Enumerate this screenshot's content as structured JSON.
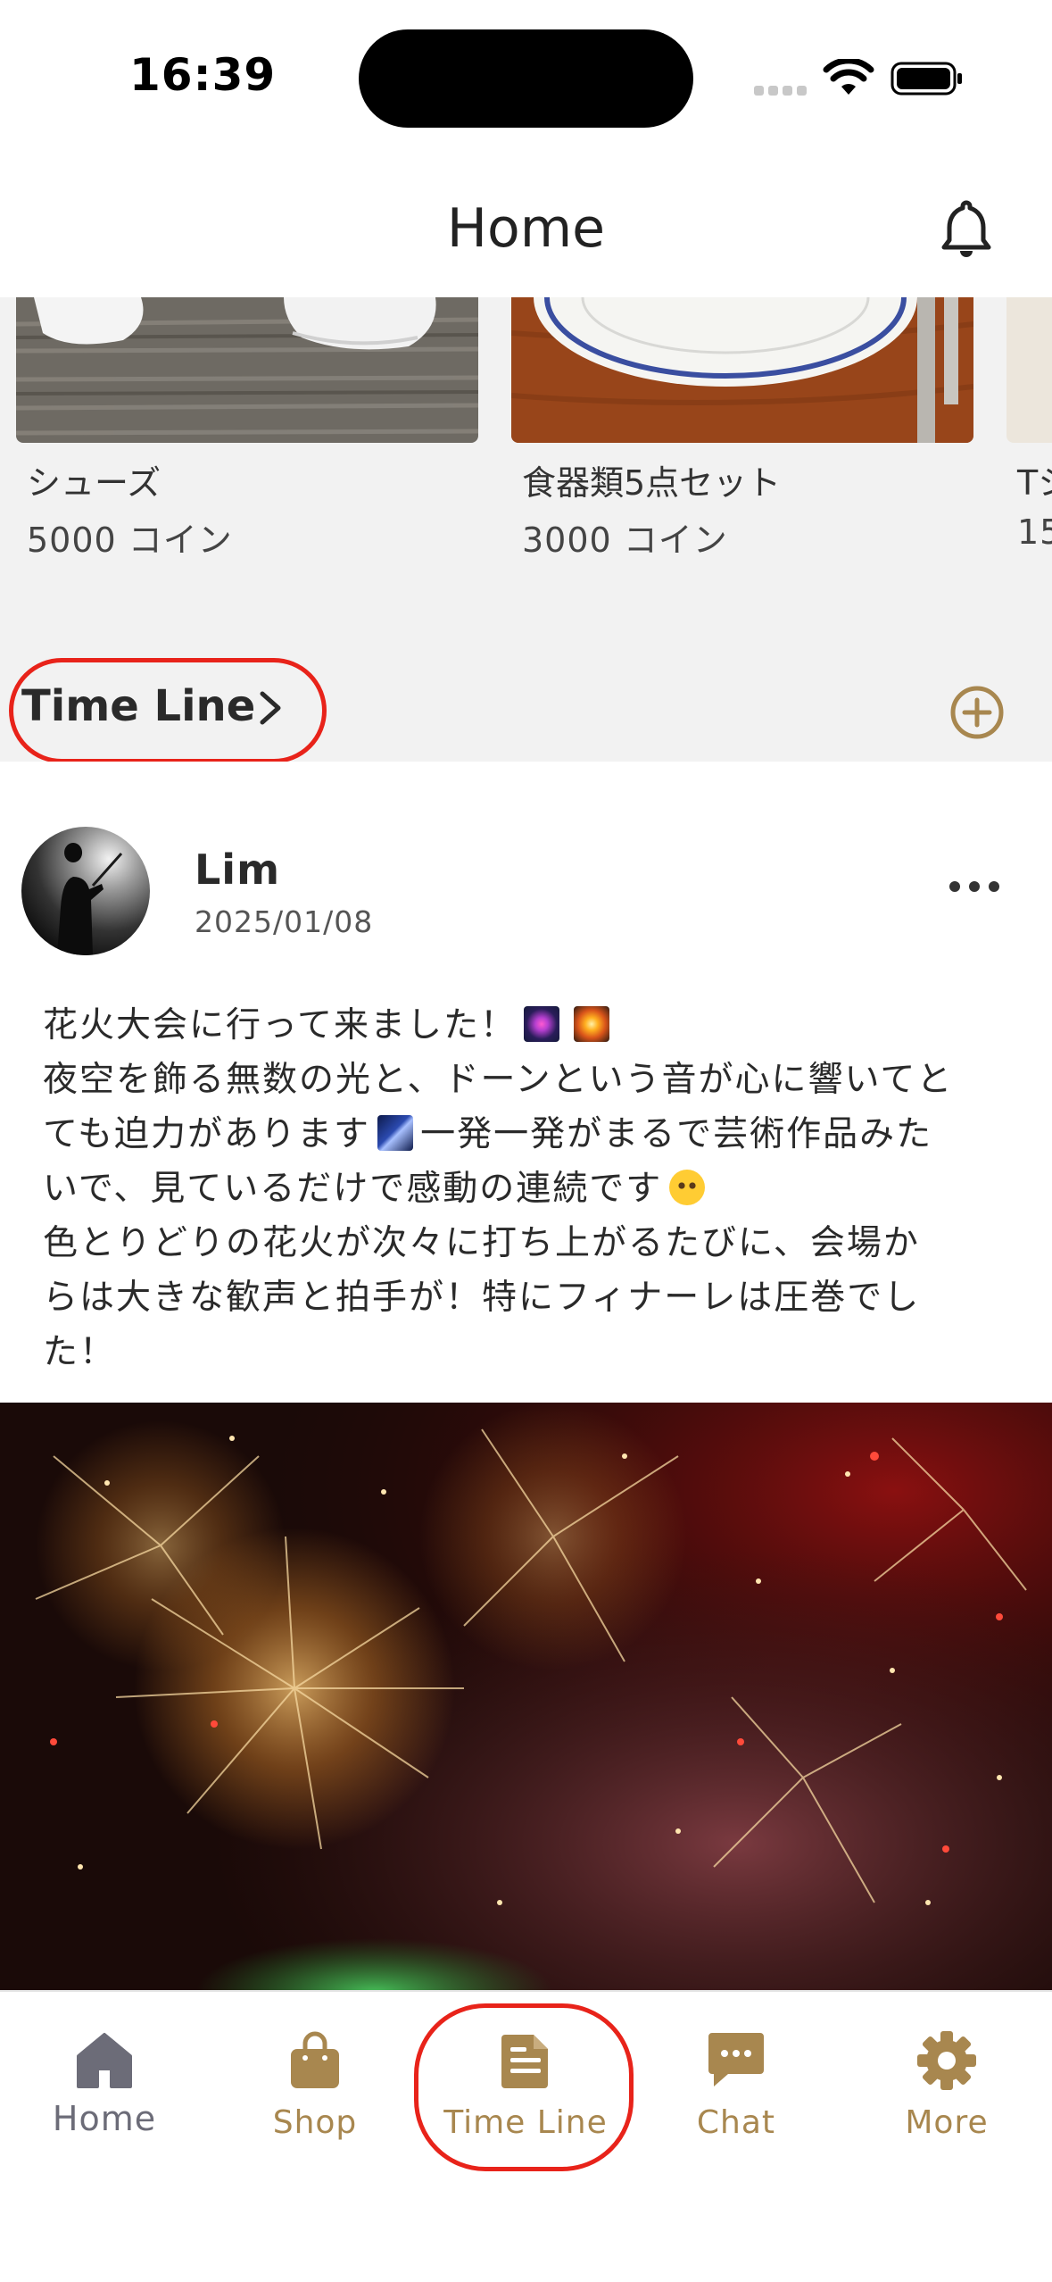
{
  "status_bar": {
    "time": "16:39"
  },
  "header": {
    "title": "Home"
  },
  "shop": {
    "products": [
      {
        "name": "シューズ",
        "price": "5000 コイン"
      },
      {
        "name": "食器類5点セット",
        "price": "3000 コイン"
      },
      {
        "name": "Tシ",
        "price": "15"
      }
    ]
  },
  "timeline": {
    "title": "Time Line"
  },
  "post": {
    "author": "Lim",
    "date": "2025/01/08",
    "lines": [
      "花火大会に行って来ました！",
      "夜空を飾る無数の光と、ドーンという音が心に響いてと",
      "ても迫力があります",
      "一発一発がまるで芸術作品みた",
      "いで、見ているだけで感動の連続です",
      "色とりどりの花火が次々に打ち上がるたびに、会場か",
      "らは大きな歓声と拍手が！特にフィナーレは圧巻でし",
      "た！"
    ]
  },
  "tabs": [
    {
      "label": "Home",
      "icon": "house-icon",
      "active": true
    },
    {
      "label": "Shop",
      "icon": "shopping-bag-icon"
    },
    {
      "label": "Time Line",
      "icon": "document-icon"
    },
    {
      "label": "Chat",
      "icon": "chat-bubble-icon"
    },
    {
      "label": "More",
      "icon": "gear-icon"
    }
  ],
  "colors": {
    "accent": "#a8874f",
    "active_tab": "#6c6c78",
    "highlight": "#e8231a",
    "section_bg": "#f2f2f2"
  }
}
